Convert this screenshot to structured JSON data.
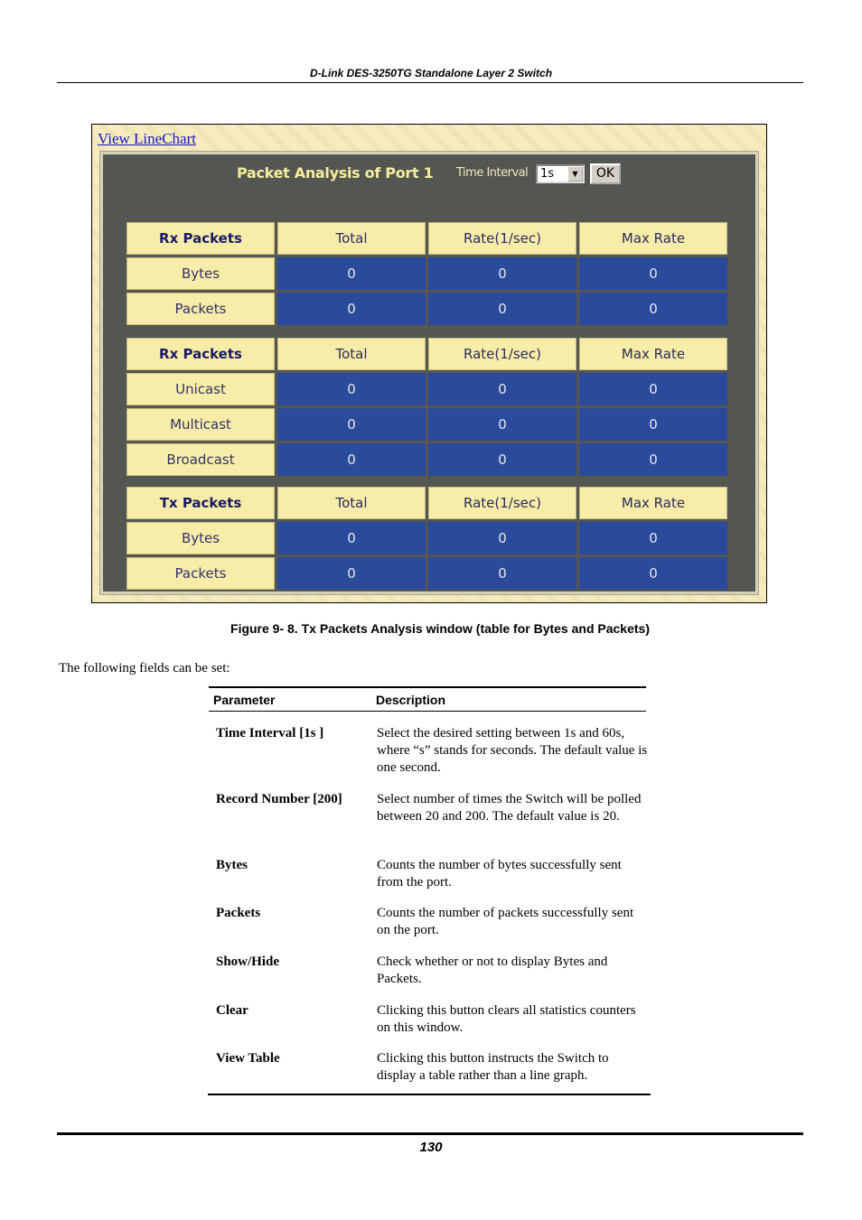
{
  "header": {
    "title": "D-Link DES-3250TG Standalone Layer 2 Switch"
  },
  "screenshot": {
    "view_link": "View LineChart",
    "panel_title": "Packet Analysis of Port 1",
    "time_interval_label": "Time Interval",
    "time_interval_value": "1s",
    "ok_label": "OK",
    "colors": {
      "header_cell": "#f8eda8",
      "value_cell": "#2a4a9c",
      "panel_bg": "#545652"
    },
    "tables": [
      {
        "columns": [
          "Rx Packets",
          "Total",
          "Rate(1/sec)",
          "Max Rate"
        ],
        "rows": [
          {
            "label": "Bytes",
            "values": [
              "0",
              "0",
              "0"
            ]
          },
          {
            "label": "Packets",
            "values": [
              "0",
              "0",
              "0"
            ]
          }
        ]
      },
      {
        "columns": [
          "Rx Packets",
          "Total",
          "Rate(1/sec)",
          "Max Rate"
        ],
        "rows": [
          {
            "label": "Unicast",
            "values": [
              "0",
              "0",
              "0"
            ]
          },
          {
            "label": "Multicast",
            "values": [
              "0",
              "0",
              "0"
            ]
          },
          {
            "label": "Broadcast",
            "values": [
              "0",
              "0",
              "0"
            ]
          }
        ]
      },
      {
        "columns": [
          "Tx Packets",
          "Total",
          "Rate(1/sec)",
          "Max Rate"
        ],
        "rows": [
          {
            "label": "Bytes",
            "values": [
              "0",
              "0",
              "0"
            ]
          },
          {
            "label": "Packets",
            "values": [
              "0",
              "0",
              "0"
            ]
          }
        ]
      }
    ]
  },
  "caption": "Figure 9- 8.  Tx Packets Analysis window (table for Bytes and Packets)",
  "intro": "The following fields can be set:",
  "param_table": {
    "headers": [
      "Parameter",
      "Description"
    ],
    "rows": [
      {
        "param": "Time Interval [1s ]",
        "desc": "Select the desired setting between 1s and 60s, where “s” stands for seconds. The default value is one second."
      },
      {
        "param": "Record Number [200]",
        "desc": "Select number of times the Switch will be polled between 20 and 200. The default value is 20."
      },
      {
        "param": "Bytes",
        "desc": "Counts the number of bytes successfully sent from the port."
      },
      {
        "param": "Packets",
        "desc": "Counts the number of packets successfully sent on the port."
      },
      {
        "param": "Show/Hide",
        "desc": "Check whether or not to display Bytes and Packets."
      },
      {
        "param": "Clear",
        "desc": "Clicking this button clears all statistics counters on this window."
      },
      {
        "param": "View Table",
        "desc": "Clicking this button instructs the Switch to display a table rather than a line graph."
      }
    ]
  },
  "page_number": "130"
}
